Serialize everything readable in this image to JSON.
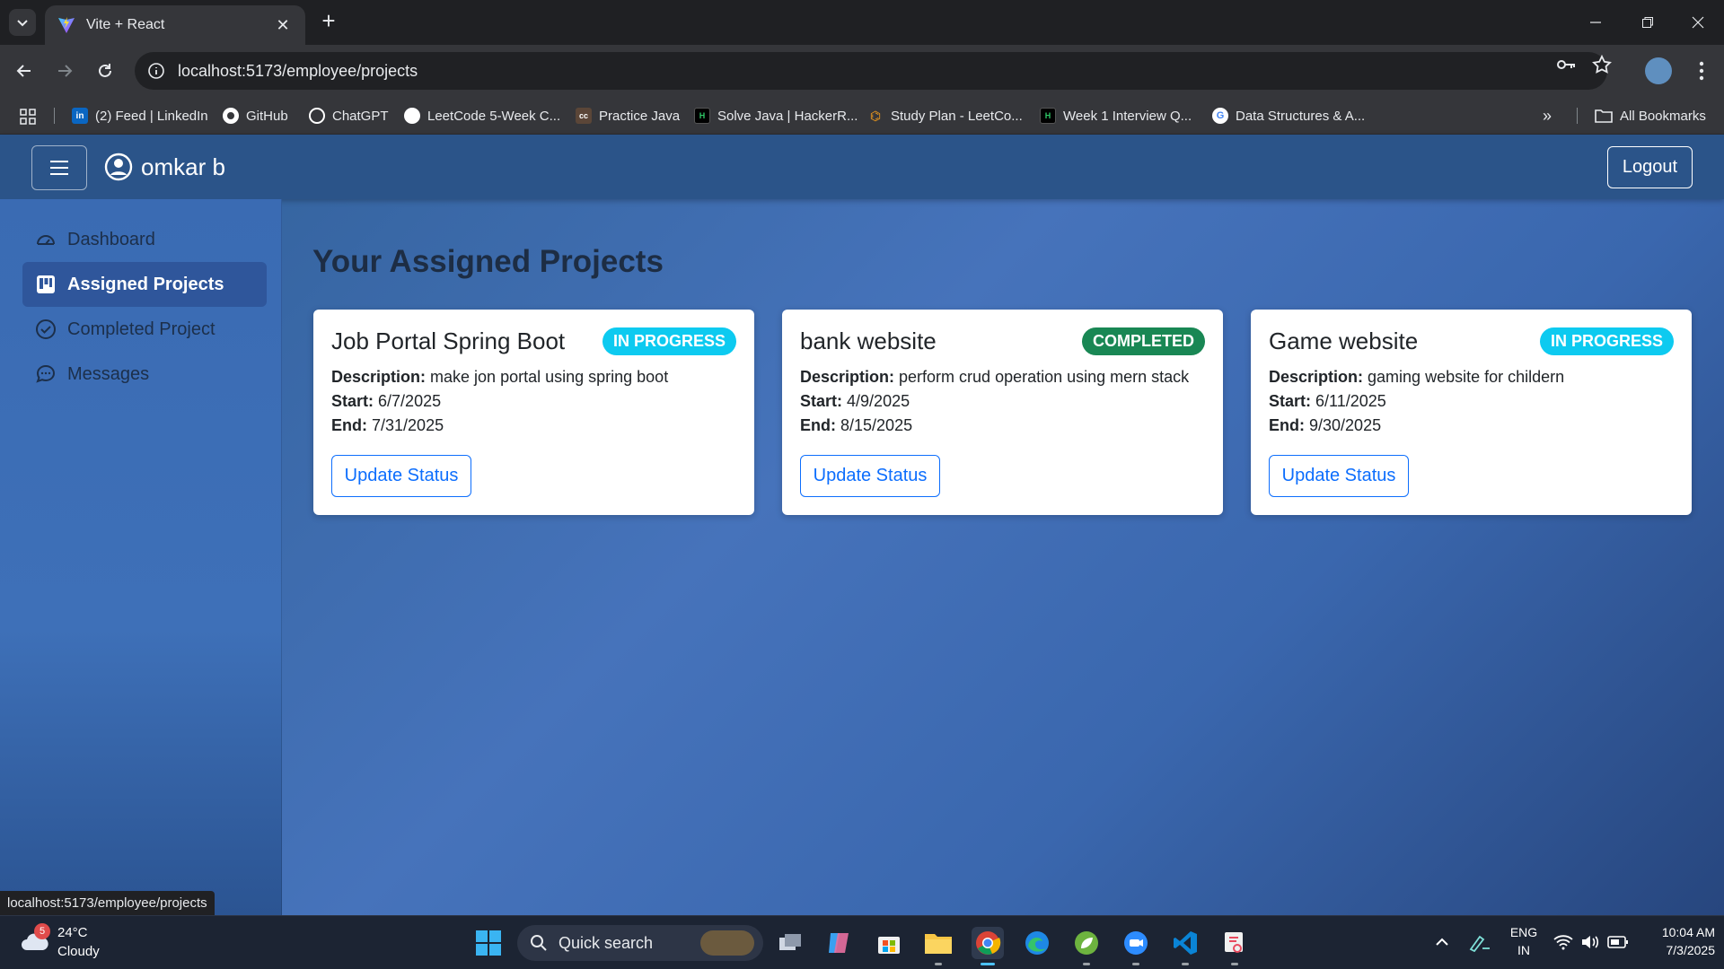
{
  "browser": {
    "tab_title": "Vite + React",
    "url": "localhost:5173/employee/projects",
    "status_url": "localhost:5173/employee/projects",
    "bookmarks": [
      {
        "label": "(2) Feed | LinkedIn",
        "icon": "linkedin-icon",
        "color": "#0a66c2"
      },
      {
        "label": "GitHub",
        "icon": "github-icon",
        "color": "#ffffff"
      },
      {
        "label": "ChatGPT",
        "icon": "chatgpt-icon",
        "color": "#ffffff"
      },
      {
        "label": "LeetCode 5-Week C...",
        "icon": "leetcode-icon",
        "color": "#ffffff"
      },
      {
        "label": "Practice Java",
        "icon": "codechef-icon",
        "color": "#5b4638"
      },
      {
        "label": "Solve Java | HackerR...",
        "icon": "hackerrank-icon",
        "color": "#000000"
      },
      {
        "label": "Study Plan - LeetCo...",
        "icon": "leetcode-icon",
        "color": "#f89f1b"
      },
      {
        "label": "Week 1 Interview Q...",
        "icon": "hackerrank-icon",
        "color": "#000000"
      },
      {
        "label": "Data Structures & A...",
        "icon": "google-icon",
        "color": "#ffffff"
      }
    ],
    "all_bookmarks": "All Bookmarks"
  },
  "app": {
    "user_name": "omkar b",
    "logout_label": "Logout",
    "sidebar": [
      {
        "label": "Dashboard",
        "icon": "speedometer-icon",
        "active": false
      },
      {
        "label": "Assigned Projects",
        "icon": "kanban-icon",
        "active": true
      },
      {
        "label": "Completed Project",
        "icon": "check-circle-icon",
        "active": false
      },
      {
        "label": "Messages",
        "icon": "chat-icon",
        "active": false
      }
    ],
    "page_title": "Your Assigned Projects",
    "labels": {
      "description": "Description:",
      "start": "Start:",
      "end": "End:"
    },
    "update_label": "Update Status",
    "projects": [
      {
        "title": "Job Portal Spring Boot",
        "status": "IN PROGRESS",
        "status_color": "#0dcaf0",
        "description": "make jon portal using spring boot",
        "start": "6/7/2025",
        "end": "7/31/2025"
      },
      {
        "title": "bank website",
        "status": "COMPLETED",
        "status_color": "#198754",
        "description": "perform crud operation using mern stack",
        "start": "4/9/2025",
        "end": "8/15/2025"
      },
      {
        "title": "Game website",
        "status": "IN PROGRESS",
        "status_color": "#0dcaf0",
        "description": "gaming website for childern",
        "start": "6/11/2025",
        "end": "9/30/2025"
      }
    ]
  },
  "taskbar": {
    "weather_badge": "5",
    "temperature": "24°C",
    "condition": "Cloudy",
    "search_placeholder": "Quick search",
    "lang_top": "ENG",
    "lang_bottom": "IN",
    "time": "10:04 AM",
    "date": "7/3/2025"
  }
}
